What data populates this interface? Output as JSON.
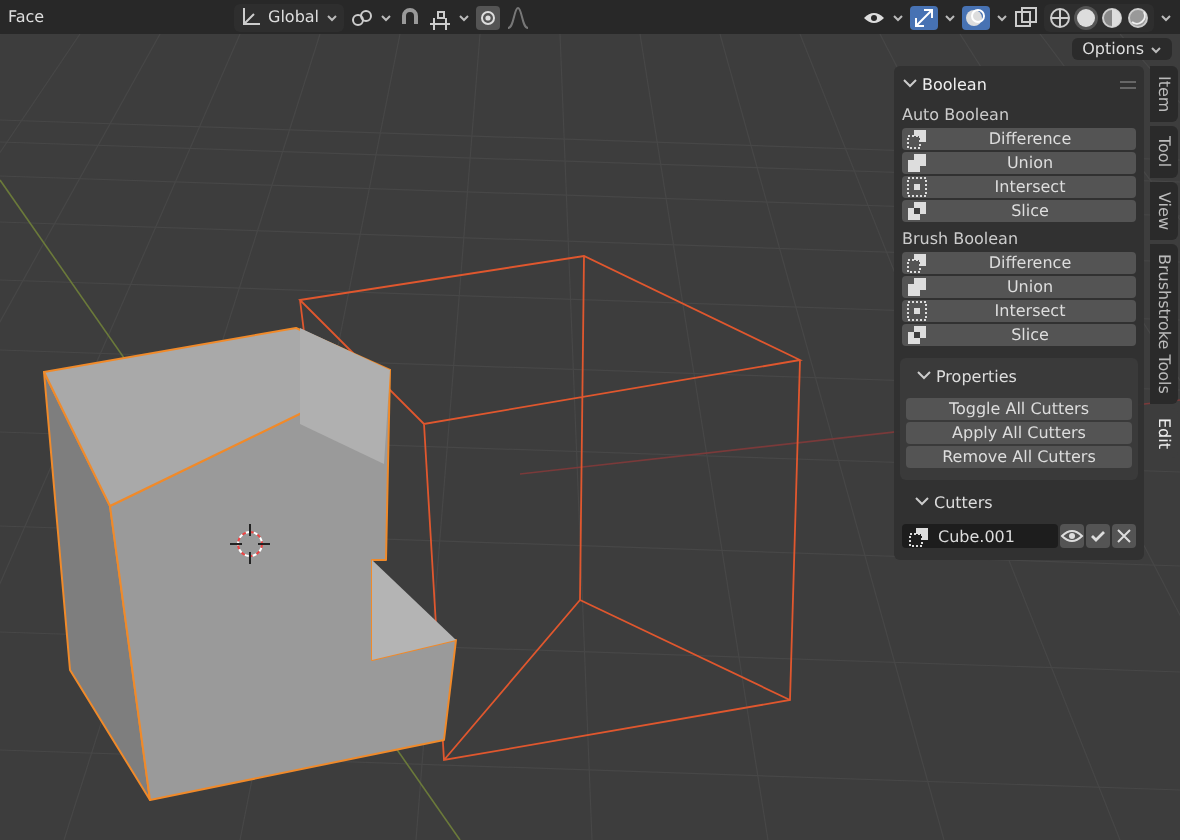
{
  "header": {
    "mode": "Face",
    "orientation": {
      "label": "Global"
    },
    "proportional_editing": {
      "on": true
    },
    "gizmo": {
      "on": true
    },
    "overlays": {
      "on": true
    },
    "xray": {
      "on": false
    },
    "shading": [
      {
        "kind": "wireframe",
        "selected": false
      },
      {
        "kind": "solid",
        "selected": true
      },
      {
        "kind": "material",
        "selected": false
      },
      {
        "kind": "rendered",
        "selected": false
      }
    ]
  },
  "options": {
    "label": "Options"
  },
  "sidebar": {
    "panel": {
      "title": "Boolean",
      "expanded": true,
      "sections": [
        {
          "title": "Auto Boolean",
          "buttons": [
            {
              "label": "Difference",
              "kind": "difference"
            },
            {
              "label": "Union",
              "kind": "union"
            },
            {
              "label": "Intersect",
              "kind": "intersect"
            },
            {
              "label": "Slice",
              "kind": "slice"
            }
          ]
        },
        {
          "title": "Brush Boolean",
          "buttons": [
            {
              "label": "Difference",
              "kind": "difference"
            },
            {
              "label": "Union",
              "kind": "union"
            },
            {
              "label": "Intersect",
              "kind": "intersect"
            },
            {
              "label": "Slice",
              "kind": "slice"
            }
          ]
        }
      ],
      "properties": {
        "title": "Properties",
        "expanded": true,
        "buttons": [
          "Toggle All Cutters",
          "Apply All Cutters",
          "Remove All Cutters"
        ]
      },
      "cutters": {
        "title": "Cutters",
        "expanded": true,
        "items": [
          {
            "name": "Cube.001",
            "kind": "difference"
          }
        ]
      }
    },
    "tabs": [
      {
        "label": "Item",
        "selected": false
      },
      {
        "label": "Tool",
        "selected": false
      },
      {
        "label": "View",
        "selected": false
      },
      {
        "label": "Brushstroke Tools",
        "selected": false
      },
      {
        "label": "Edit",
        "selected": true
      }
    ]
  }
}
